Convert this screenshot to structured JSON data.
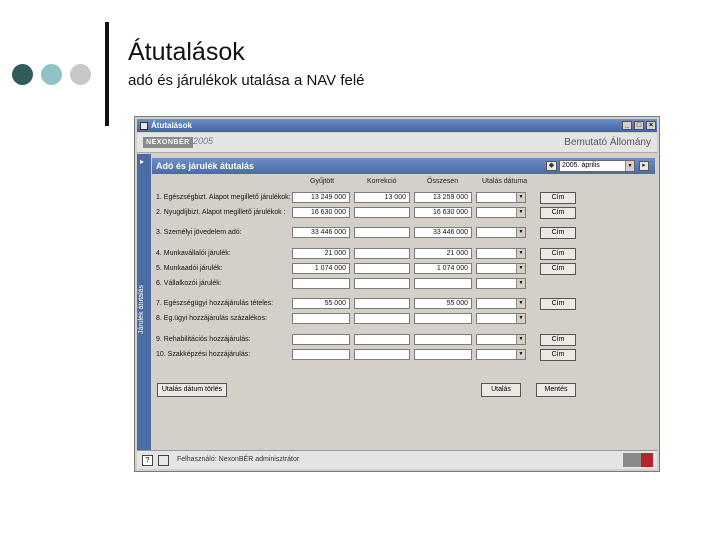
{
  "slide": {
    "title": "Átutalások",
    "subtitle": "adó és járulékok utalása a NAV felé"
  },
  "window": {
    "title": "Átutalások",
    "brand_logo": "NEXONBÉR",
    "brand_year": "2005",
    "brand_right": "Bemutató Állomány",
    "sidebar_label": "Járulék átutalás",
    "panel_title": "Adó és járulék átutalás",
    "period": "2005. április",
    "columns": [
      "Gyűjtött",
      "Korrekció",
      "Összesen",
      "Utalás dátuma"
    ],
    "rows": [
      {
        "label": "1. Egészségbizt. Alapot megillető járulékok:",
        "gyujtott": "13 249 000",
        "korrekcio": "13 000",
        "osszesen": "13 259 000"
      },
      {
        "label": "2. Nyugdíjbizt. Alapot megillető járulékok :",
        "gyujtott": "16 630 000",
        "korrekcio": "",
        "osszesen": "16 630 000"
      },
      {
        "label": "3. Személyi jövedelem adó:",
        "gyujtott": "33 446 000",
        "korrekcio": "",
        "osszesen": "33 446 000"
      },
      {
        "label": "4. Munkavállalói járulék:",
        "gyujtott": "21 000",
        "korrekcio": "",
        "osszesen": "21 000"
      },
      {
        "label": "5. Munkaadói járulék:",
        "gyujtott": "1 074 000",
        "korrekcio": "",
        "osszesen": "1 074 000"
      },
      {
        "label": "6. Vállalkozói járulék:",
        "gyujtott": "",
        "korrekcio": "",
        "osszesen": ""
      },
      {
        "label": "7. Egészségügyi hozzájárulás tételes:",
        "gyujtott": "55 000",
        "korrekcio": "",
        "osszesen": "55 000"
      },
      {
        "label": "8. Eg.ügyi hozzájárulás százalékos:",
        "gyujtott": "",
        "korrekcio": "",
        "osszesen": ""
      },
      {
        "label": "9. Rehabilitációs hozzájárulás:",
        "gyujtott": "",
        "korrekcio": "",
        "osszesen": ""
      },
      {
        "label": "10. Szakképzési hozzájárulás:",
        "gyujtott": "",
        "korrekcio": "",
        "osszesen": ""
      }
    ],
    "cim_label": "Cím",
    "btn_clear_dates": "Utalás dátum törlés",
    "btn_transfer": "Utalás",
    "btn_save": "Mentés",
    "status_text": "Felhasználó: NexonBÉR adminisztrátor"
  }
}
